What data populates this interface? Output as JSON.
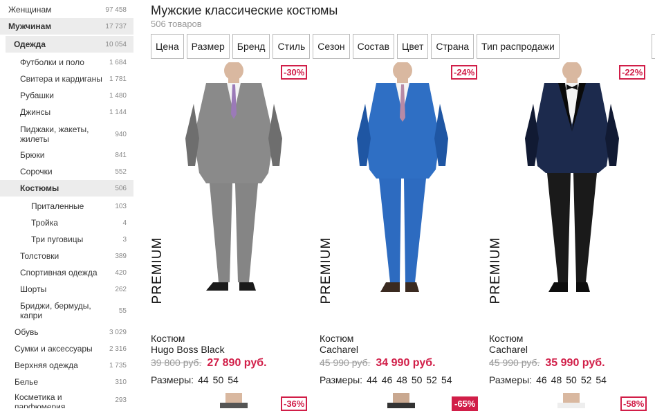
{
  "sidebar": {
    "items": [
      {
        "label": "Женщинам",
        "count": "97 458"
      },
      {
        "label": "Мужчинам",
        "count": "17 737"
      },
      {
        "label": "Одежда",
        "count": "10 054"
      },
      {
        "label": "Футболки и поло",
        "count": "1 684"
      },
      {
        "label": "Свитера и кардиганы",
        "count": "1 781"
      },
      {
        "label": "Рубашки",
        "count": "1 480"
      },
      {
        "label": "Джинсы",
        "count": "1 144"
      },
      {
        "label": "Пиджаки, жакеты, жилеты",
        "count": "940"
      },
      {
        "label": "Брюки",
        "count": "841"
      },
      {
        "label": "Сорочки",
        "count": "552"
      },
      {
        "label": "Костюмы",
        "count": "506"
      },
      {
        "label": "Приталенные",
        "count": "103"
      },
      {
        "label": "Тройка",
        "count": "4"
      },
      {
        "label": "Три пуговицы",
        "count": "3"
      },
      {
        "label": "Толстовки",
        "count": "389"
      },
      {
        "label": "Спортивная одежда",
        "count": "420"
      },
      {
        "label": "Шорты",
        "count": "262"
      },
      {
        "label": "Бриджи, бермуды, капри",
        "count": "55"
      },
      {
        "label": "Обувь",
        "count": "3 029"
      },
      {
        "label": "Сумки и аксессуары",
        "count": "2 316"
      },
      {
        "label": "Верхняя одежда",
        "count": "1 735"
      },
      {
        "label": "Белье",
        "count": "310"
      },
      {
        "label": "Косметика и парфюмерия",
        "count": "293"
      }
    ]
  },
  "header": {
    "title": "Мужские классические костюмы",
    "subtitle": "506 товаров"
  },
  "filters": [
    "Цена",
    "Размер",
    "Бренд",
    "Стиль",
    "Сезон",
    "Состав",
    "Цвет",
    "Страна",
    "Тип распродажи"
  ],
  "products": [
    {
      "discount": "-30%",
      "premium": "PREMIUM",
      "type": "Костюм",
      "brand": "Hugo Boss Black",
      "old_price": "39 800 руб.",
      "new_price": "27 890 руб.",
      "sizes_label": "Размеры:",
      "sizes": [
        "44",
        "50",
        "54"
      ],
      "suit_color": "#8a8a8a",
      "suit_shade": "#6e6e6e",
      "tie_color": "#9b7ab8",
      "pants_color": "#858585"
    },
    {
      "discount": "-24%",
      "premium": "PREMIUM",
      "type": "Костюм",
      "brand": "Cacharel",
      "old_price": "45 990 руб.",
      "new_price": "34 990 руб.",
      "sizes_label": "Размеры:",
      "sizes": [
        "44",
        "46",
        "48",
        "50",
        "52",
        "54"
      ],
      "suit_color": "#2f6fc4",
      "suit_shade": "#1f56a3",
      "tie_color": "#b78aa6",
      "pants_color": "#2d6bc0"
    },
    {
      "discount": "-22%",
      "premium": "PREMIUM",
      "type": "Костюм",
      "brand": "Cacharel",
      "old_price": "45 990 руб.",
      "new_price": "35 990 руб.",
      "sizes_label": "Размеры:",
      "sizes": [
        "46",
        "48",
        "50",
        "52",
        "54"
      ],
      "suit_color": "#1c2a4d",
      "suit_shade": "#111a33",
      "tie_color": "#111111",
      "pants_color": "#1a1a1a"
    }
  ],
  "next_row_discounts": [
    "-36%",
    "-65%",
    "-58%"
  ],
  "colors": {
    "accent": "#d11e48",
    "active_bg": "#ececec"
  }
}
